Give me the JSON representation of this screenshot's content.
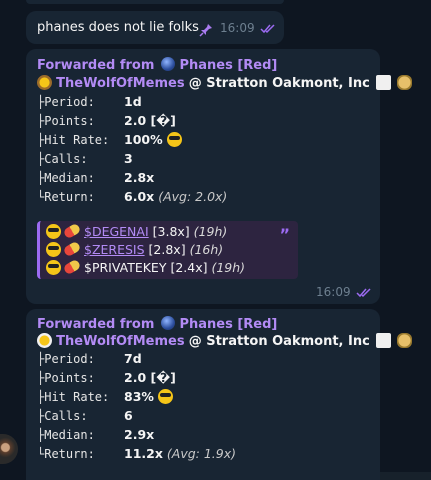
{
  "short_message": {
    "text": "phanes does not lie folks",
    "time": "16:09"
  },
  "messages": [
    {
      "forwarded_label": "Forwarded from",
      "forwarded_source": "Phanes [Red]",
      "author_name": "TheWolfOfMemes",
      "author_rest": "@ Stratton Oakmont, Inc",
      "period_label": "├Period:",
      "period": "1d",
      "points_label": "├Points:",
      "points": "2.0 [�]",
      "hitrate_label": "├Hit Rate:",
      "hitrate": "100%",
      "calls_label": "├Calls:",
      "calls": "3",
      "median_label": "├Median:",
      "median": "2.8x",
      "return_label": "└Return:",
      "return": "6.0x",
      "return_avg": "(Avg: 2.0x)",
      "quote": [
        {
          "ticker": "$DEGENAI",
          "mult": "[3.8x]",
          "hrs": "(19h)",
          "style": "link"
        },
        {
          "ticker": "$ZERESIS",
          "mult": "[2.8x]",
          "hrs": "(16h)",
          "style": "link"
        },
        {
          "ticker": "$PRIVATEKEY",
          "mult": "[2.4x]",
          "hrs": "(19h)",
          "style": "plain"
        }
      ],
      "quote_mark": "”",
      "time": "16:09"
    },
    {
      "forwarded_label": "Forwarded from",
      "forwarded_source": "Phanes [Red]",
      "author_name": "TheWolfOfMemes",
      "author_rest": "@ Stratton Oakmont, Inc",
      "period_label": "├Period:",
      "period": "7d",
      "points_label": "├Points:",
      "points": "2.0 [�]",
      "hitrate_label": "├Hit Rate:",
      "hitrate": "83%",
      "calls_label": "├Calls:",
      "calls": "6",
      "median_label": "├Median:",
      "median": "2.9x",
      "return_label": "└Return:",
      "return": "11.2x",
      "return_avg": "(Avg: 1.9x)"
    }
  ],
  "colors": {
    "background": "#0e1621",
    "bubble": "#182533",
    "accent": "#b38bf5",
    "quote_bg": "#2d2440"
  }
}
